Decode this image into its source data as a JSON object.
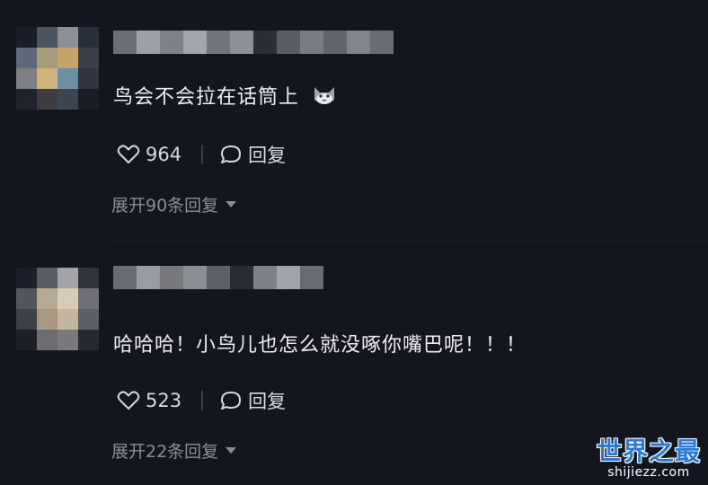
{
  "comments": [
    {
      "text": "鸟会不会拉在话筒上",
      "emoji_icon": "cat-face-icon",
      "likes": "964",
      "reply_label": "回复",
      "expand_label": "展开90条回复"
    },
    {
      "text": "哈哈哈！小鸟儿也怎么就没啄你嘴巴呢！！！",
      "likes": "523",
      "reply_label": "回复",
      "expand_label": "展开22条回复"
    }
  ],
  "watermark": {
    "title": "世界之最",
    "url": "shijiezz.com"
  },
  "colors": {
    "background": "#14161f",
    "text": "#eceef3",
    "muted": "#8a8d99",
    "watermark_blue": "#2a7ad6"
  }
}
